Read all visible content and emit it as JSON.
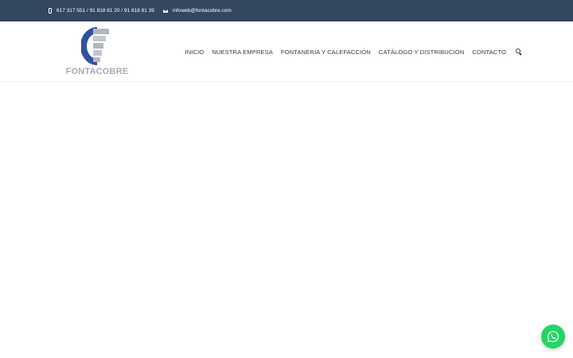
{
  "topbar": {
    "phone": "617 317 551 / 91 818 81 20 / 91 818 81 39",
    "phone_icon": "mobile-phone-icon",
    "email": "infoweb@fontacobre.com",
    "email_icon": "envelope-icon"
  },
  "brand": {
    "name": "FONTACOBRE",
    "colors": {
      "blue": "#2f4fa0",
      "gray": "#a7acb2"
    }
  },
  "nav": {
    "items": [
      "INICIO",
      "NUESTRA EMPRESA",
      "FONTANERIA Y CALEFACCIÓN",
      "CATÁLOGO Y DISTRIBUCIÓN",
      "CONTACTO"
    ],
    "search_icon": "search-icon"
  },
  "colors": {
    "topbar_bg": "#33475f",
    "whatsapp": "#25d366"
  },
  "whatsapp": {
    "icon": "whatsapp-icon"
  }
}
